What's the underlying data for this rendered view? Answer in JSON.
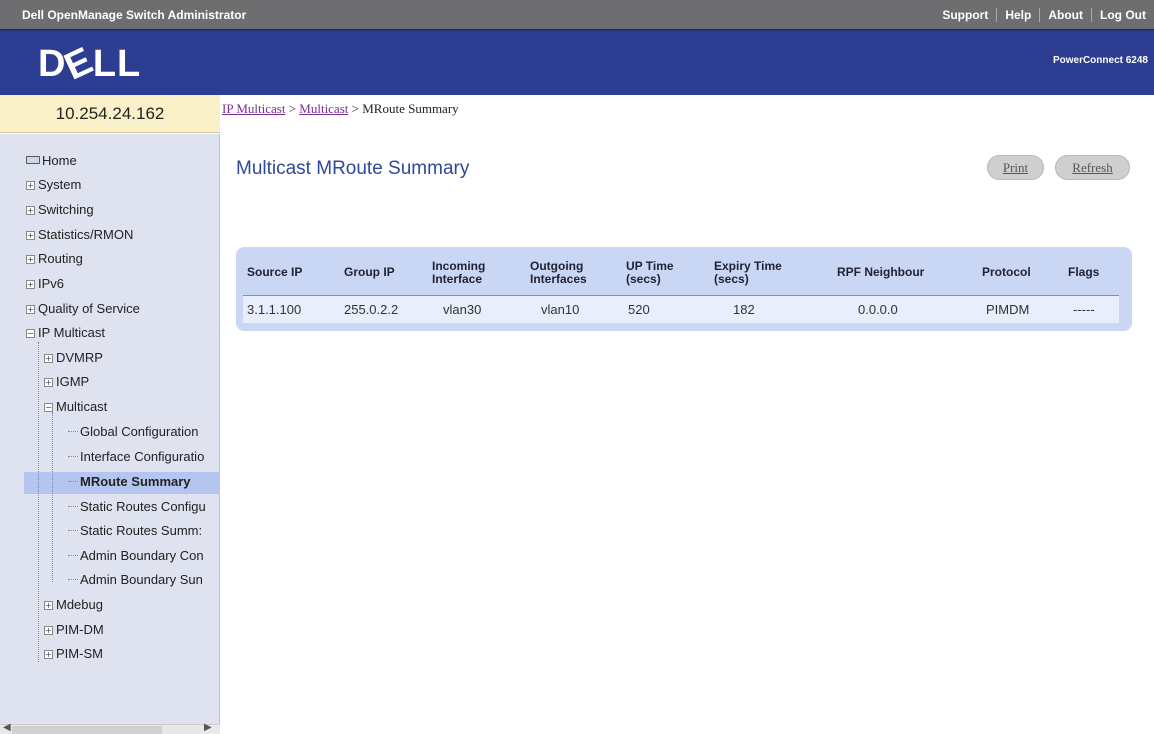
{
  "app_title": "Dell OpenManage Switch Administrator",
  "top_links": [
    "Support",
    "Help",
    "About",
    "Log Out"
  ],
  "logo_text": "DELL",
  "model": "PowerConnect 6248",
  "ip_address": "10.254.24.162",
  "nav": {
    "home": "Home",
    "system": "System",
    "switching": "Switching",
    "statistics": "Statistics/RMON",
    "routing": "Routing",
    "ipv6": "IPv6",
    "qos": "Quality of Service",
    "ip_multicast": "IP Multicast",
    "dvmrp": "DVMRP",
    "igmp": "IGMP",
    "multicast": "Multicast",
    "global_config": "Global Configuration",
    "interface_config": "Interface Configuratio",
    "mroute_summary": "MRoute Summary",
    "static_routes_config": "Static Routes Configu",
    "static_routes_summary": "Static Routes Summ:",
    "admin_boundary_config": "Admin Boundary Con",
    "admin_boundary_summary": "Admin Boundary Sun",
    "mdebug": "Mdebug",
    "pim_dm": "PIM-DM",
    "pim_sm": "PIM-SM"
  },
  "breadcrumb": {
    "link1": "IP Multicast",
    "sep1": " > ",
    "link2": "Multicast",
    "sep2": " > ",
    "current": "MRoute Summary"
  },
  "page_title": "Multicast MRoute Summary",
  "buttons": {
    "print": "Print",
    "refresh": "Refresh"
  },
  "table": {
    "headers": {
      "source_ip": "Source IP",
      "group_ip": "Group IP",
      "incoming_1": "Incoming",
      "incoming_2": "Interface",
      "outgoing_1": "Outgoing",
      "outgoing_2": "Interfaces",
      "uptime_1": "UP Time",
      "uptime_2": "(secs)",
      "expiry_1": "Expiry Time",
      "expiry_2": "(secs)",
      "rpf": "RPF Neighbour",
      "protocol": "Protocol",
      "flags": "Flags"
    },
    "row": {
      "source_ip": "3.1.1.100",
      "group_ip": "255.0.2.2",
      "incoming": "vlan30",
      "outgoing": "vlan10",
      "uptime": "520",
      "expiry": "182",
      "rpf": "0.0.0.0",
      "protocol": "PIMDM",
      "flags": "-----"
    }
  }
}
